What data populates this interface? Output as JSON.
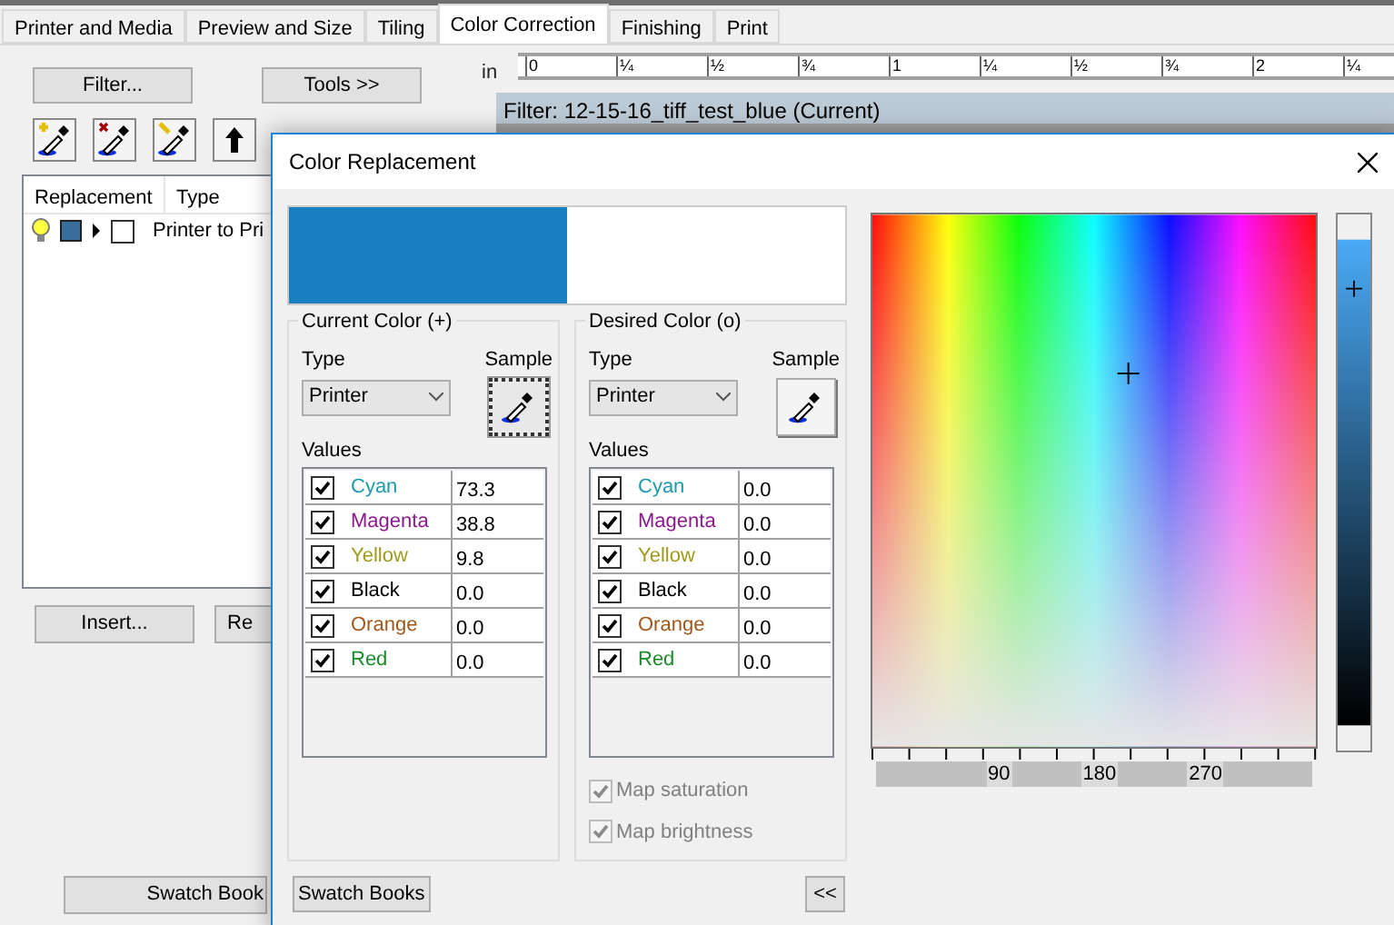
{
  "tabs": [
    {
      "label": "Printer and Media",
      "selected": false
    },
    {
      "label": "Preview and Size",
      "selected": false
    },
    {
      "label": "Tiling",
      "selected": false
    },
    {
      "label": "Color Correction",
      "selected": true
    },
    {
      "label": "Finishing",
      "selected": false
    },
    {
      "label": "Print",
      "selected": false
    }
  ],
  "left_panel": {
    "top_buttons": [
      "Filter...",
      "Tools >>"
    ],
    "columns": [
      "Replacement",
      "Type"
    ],
    "rows": [
      {
        "expanded": false,
        "checked": false,
        "type": "Printer to Pri"
      }
    ],
    "lower_buttons": [
      "Insert...",
      "Re"
    ],
    "swatch_button": "Swatch Book"
  },
  "ruler": {
    "unit": "in",
    "labels": [
      "0",
      "¼",
      "½",
      "¾",
      "1",
      "¼",
      "½",
      "¾",
      "2",
      "¼"
    ]
  },
  "filter_bar": "Filter: 12-15-16_tiff_test_blue (Current)",
  "dialog": {
    "title": "Color Replacement",
    "preview": [
      {
        "color": "#1a7fc1"
      },
      {
        "color": "#ffffff"
      }
    ],
    "groups": [
      {
        "title": "Current Color (+)",
        "type_label": "Type",
        "type_value": "Printer",
        "sample_label": "Sample",
        "sample_focused": true,
        "values_label": "Values",
        "channels": [
          {
            "name": "Cyan",
            "color": "#1a9aa8",
            "checked": true,
            "value": "73.3"
          },
          {
            "name": "Magenta",
            "color": "#8a1a8a",
            "checked": true,
            "value": "38.8"
          },
          {
            "name": "Yellow",
            "color": "#a09a1a",
            "checked": true,
            "value": "9.8"
          },
          {
            "name": "Black",
            "color": "#000000",
            "checked": true,
            "value": "0.0"
          },
          {
            "name": "Orange",
            "color": "#a0581a",
            "checked": true,
            "value": "0.0"
          },
          {
            "name": "Red",
            "color": "#1a8a2a",
            "checked": true,
            "value": "0.0"
          }
        ]
      },
      {
        "title": "Desired Color (o)",
        "type_label": "Type",
        "type_value": "Printer",
        "sample_label": "Sample",
        "sample_focused": false,
        "values_label": "Values",
        "channels": [
          {
            "name": "Cyan",
            "color": "#1a9aa8",
            "checked": true,
            "value": "0.0"
          },
          {
            "name": "Magenta",
            "color": "#8a1a8a",
            "checked": true,
            "value": "0.0"
          },
          {
            "name": "Yellow",
            "color": "#a09a1a",
            "checked": true,
            "value": "0.0"
          },
          {
            "name": "Black",
            "color": "#000000",
            "checked": true,
            "value": "0.0"
          },
          {
            "name": "Orange",
            "color": "#a0581a",
            "checked": true,
            "value": "0.0"
          },
          {
            "name": "Red",
            "color": "#1a8a2a",
            "checked": true,
            "value": "0.0"
          }
        ],
        "options": [
          {
            "label": "Map saturation",
            "checked": true,
            "disabled": true
          },
          {
            "label": "Map brightness",
            "checked": true,
            "disabled": true
          }
        ]
      }
    ],
    "hue_axis": [
      "90",
      "180",
      "270"
    ],
    "swatch_books": "Swatch Books",
    "collapse": "<<"
  }
}
